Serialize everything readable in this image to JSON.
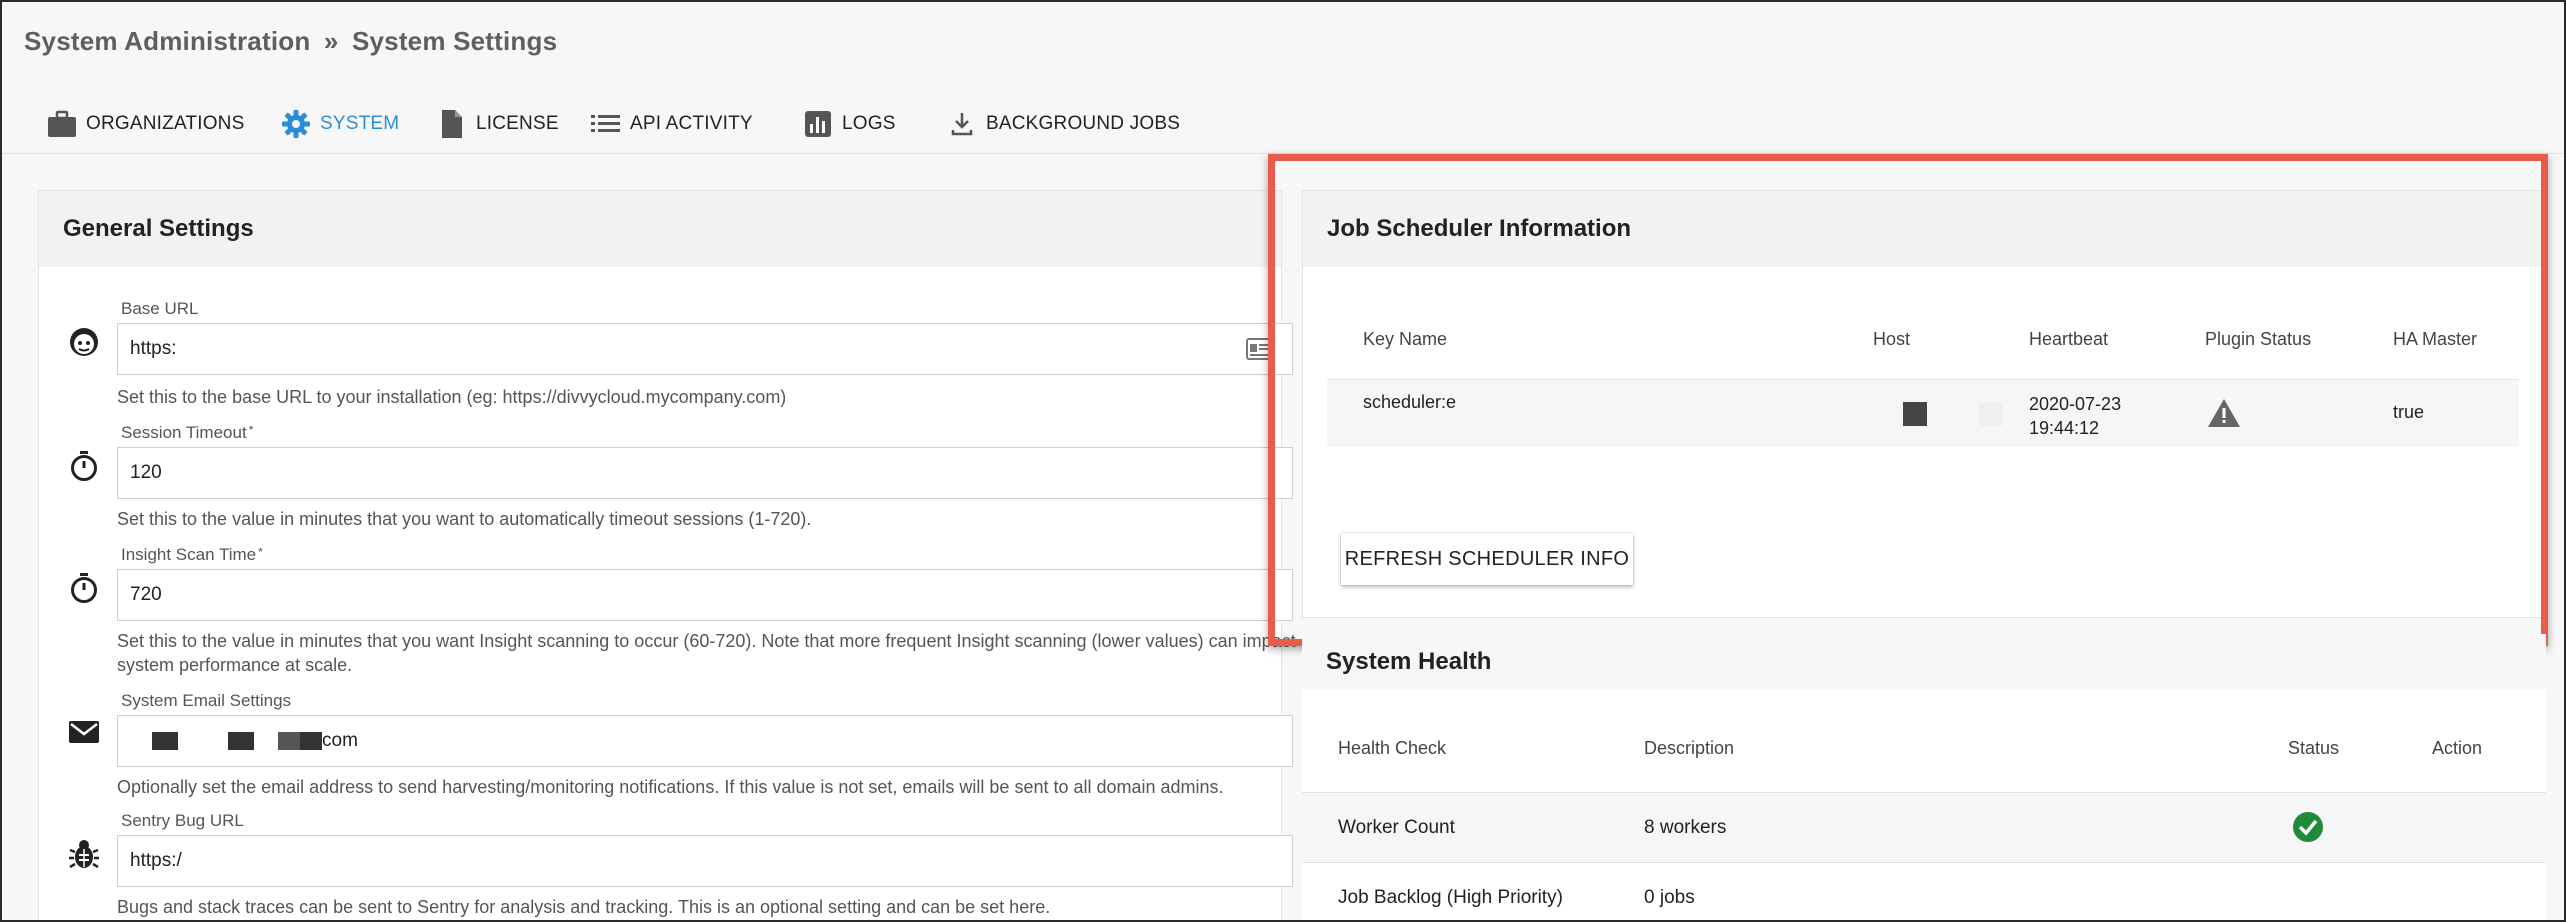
{
  "breadcrumb": {
    "parent": "System Administration",
    "separator": "»",
    "current": "System Settings"
  },
  "tabs": [
    {
      "label": "ORGANIZATIONS",
      "icon": "briefcase-icon"
    },
    {
      "label": "SYSTEM",
      "icon": "gear-icon",
      "active": true
    },
    {
      "label": "LICENSE",
      "icon": "document-icon"
    },
    {
      "label": "API ACTIVITY",
      "icon": "list-icon"
    },
    {
      "label": "LOGS",
      "icon": "bar-chart-icon"
    },
    {
      "label": "BACKGROUND JOBS",
      "icon": "download-icon"
    }
  ],
  "general": {
    "title": "General Settings",
    "settings": [
      {
        "label": "Base URL",
        "value": "https:",
        "help": "Set this to the base URL to your installation (eg: https://divvycloud.mycompany.com)",
        "icon": "face-icon"
      },
      {
        "label": "Session Timeout",
        "required": "*",
        "value": "120",
        "help": "Set this to the value in minutes that you want to automatically timeout sessions (1-720).",
        "icon": "stopwatch-icon"
      },
      {
        "label": "Insight Scan Time",
        "required": "*",
        "value": "720",
        "help": "Set this to the value in minutes that you want Insight scanning to occur (60-720). Note that more frequent Insight scanning (lower values) can impact system performance at scale.",
        "icon": "stopwatch-icon"
      },
      {
        "label": "System Email Settings",
        "value": "com",
        "help": "Optionally set the email address to send harvesting/monitoring notifications. If this value is not set, emails will be sent to all domain admins.",
        "icon": "envelope-icon"
      },
      {
        "label": "Sentry Bug URL",
        "value": "https:/",
        "help": "Bugs and stack traces can be sent to Sentry for analysis and tracking. This is an optional setting and can be set here.",
        "icon": "bug-icon"
      }
    ]
  },
  "scheduler": {
    "title": "Job Scheduler Information",
    "columns": [
      "Key Name",
      "Host",
      "Heartbeat",
      "Plugin Status",
      "HA Master"
    ],
    "row": {
      "key_name": "scheduler:e",
      "heartbeat_date": "2020-07-23",
      "heartbeat_time": "19:44:12",
      "plugin_status_icon": "warning-icon",
      "ha_master": "true"
    },
    "refresh_label": "REFRESH SCHEDULER INFO"
  },
  "health": {
    "title": "System Health",
    "columns": [
      "Health Check",
      "Description",
      "Status",
      "Action"
    ],
    "rows": [
      {
        "check": "Worker Count",
        "description": "8 workers",
        "status_icon": "check-circle-icon"
      },
      {
        "check": "Job Backlog (High Priority)",
        "description": "0 jobs"
      }
    ]
  },
  "colors": {
    "accent": "#2a8dd8",
    "highlight": "#ea5b4c",
    "success": "#1f8a3a"
  }
}
